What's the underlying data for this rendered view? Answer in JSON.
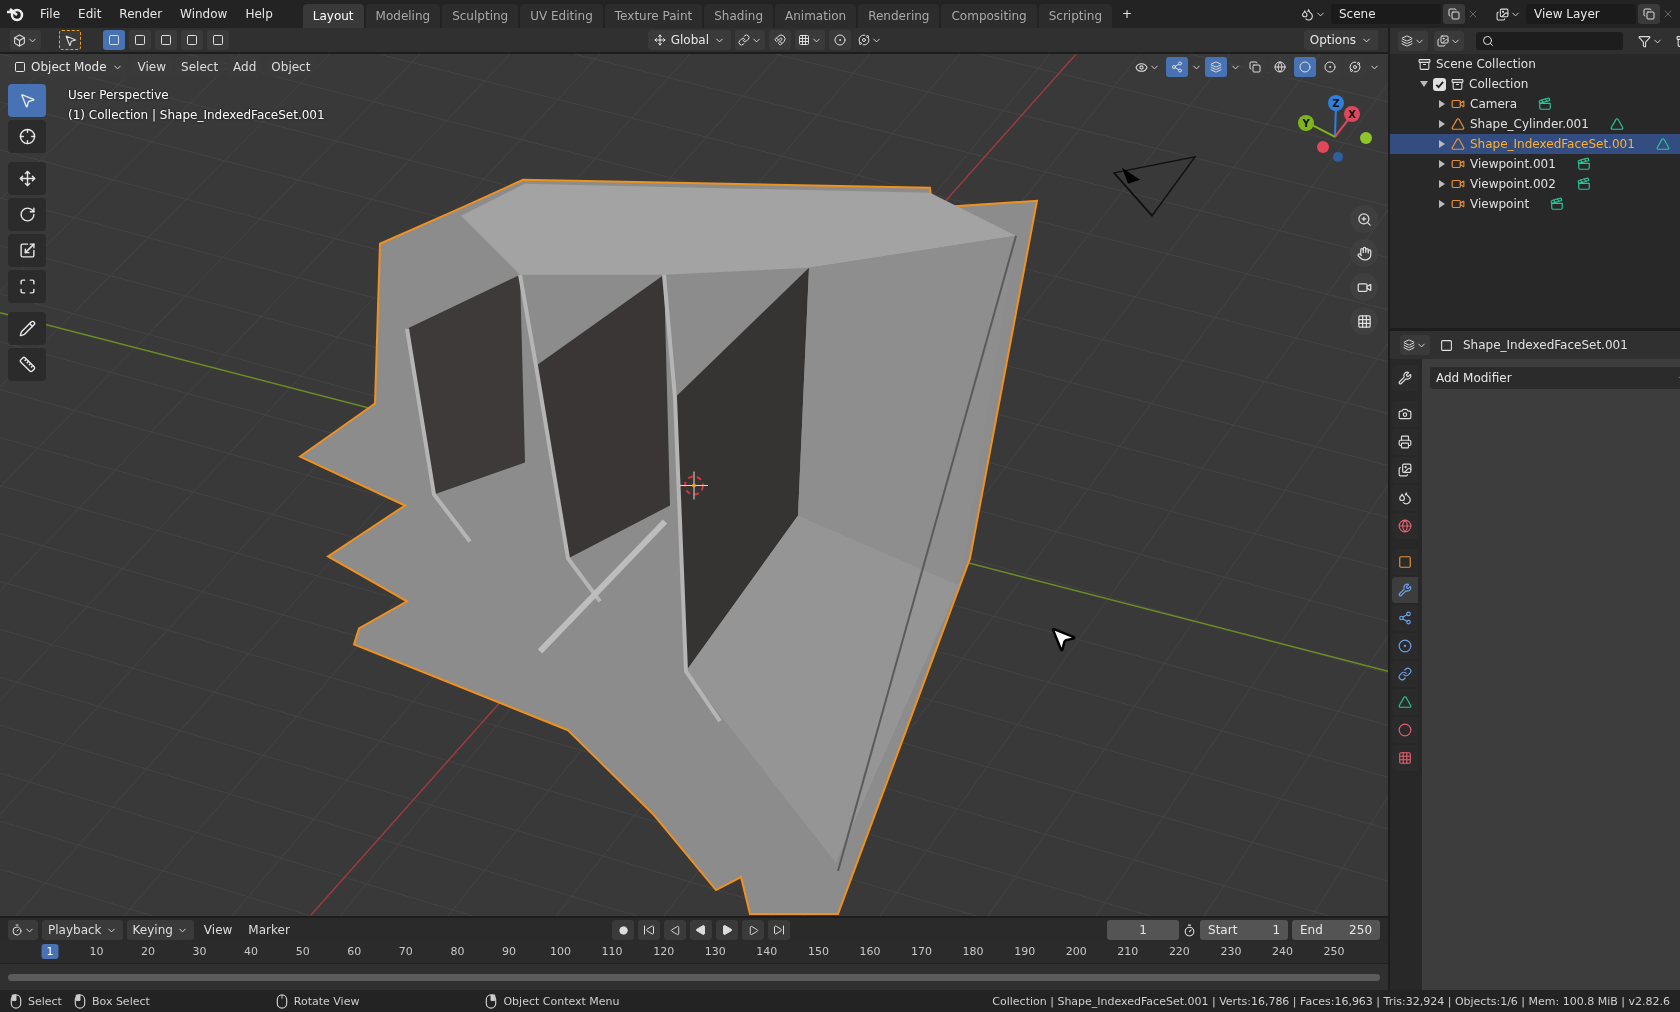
{
  "topbar": {
    "menus": [
      "File",
      "Edit",
      "Render",
      "Window",
      "Help"
    ],
    "workspaces": [
      {
        "label": "Layout",
        "selected": true
      },
      {
        "label": "Modeling",
        "selected": false
      },
      {
        "label": "Sculpting",
        "selected": false
      },
      {
        "label": "UV Editing",
        "selected": false
      },
      {
        "label": "Texture Paint",
        "selected": false
      },
      {
        "label": "Shading",
        "selected": false
      },
      {
        "label": "Animation",
        "selected": false
      },
      {
        "label": "Rendering",
        "selected": false
      },
      {
        "label": "Compositing",
        "selected": false
      },
      {
        "label": "Scripting",
        "selected": false
      }
    ],
    "add_workspace": "+",
    "scene": "Scene",
    "view_layer": "View Layer"
  },
  "tool_header": {
    "select_modes": [
      {
        "selected": true
      },
      {
        "selected": false
      },
      {
        "selected": false
      },
      {
        "selected": false
      },
      {
        "selected": false
      }
    ],
    "orientation": "Global",
    "options": "Options"
  },
  "viewport": {
    "mode": "Object Mode",
    "menus": [
      "View",
      "Select",
      "Add",
      "Object"
    ],
    "overlay_text": [
      "User Perspective",
      "(1) Collection | Shape_IndexedFaceSet.001"
    ],
    "gizmo_toggle": true,
    "overlay_toggle": true,
    "shading": [
      {
        "kind": "wireframe",
        "selected": false
      },
      {
        "kind": "solid",
        "selected": true
      },
      {
        "kind": "material",
        "selected": false
      },
      {
        "kind": "rendered",
        "selected": false
      }
    ],
    "tools": [
      {
        "kind": "select",
        "selected": true
      },
      {
        "kind": "cursor",
        "selected": false
      },
      {
        "kind": "move",
        "selected": false
      },
      {
        "kind": "rotate",
        "selected": false
      },
      {
        "kind": "scale",
        "selected": false
      },
      {
        "kind": "transform",
        "selected": false
      },
      {
        "kind": "annotate",
        "selected": false
      },
      {
        "kind": "measure",
        "selected": false
      }
    ],
    "gizmo_axes": [
      {
        "label": "Z",
        "color": "#2f7fdc"
      },
      {
        "label": "X",
        "color": "#e0475a"
      },
      {
        "label": "Y",
        "color": "#7fb51b"
      }
    ]
  },
  "outliner": {
    "root": "Scene Collection",
    "collections": [
      {
        "label": "Collection",
        "checked": true,
        "expanded": true,
        "children": [
          {
            "label": "Camera",
            "kind": "camera",
            "expanded": false,
            "selected": false
          },
          {
            "label": "Shape_Cylinder.001",
            "kind": "mesh",
            "expanded": false,
            "selected": false
          },
          {
            "label": "Shape_IndexedFaceSet.001",
            "kind": "mesh",
            "expanded": false,
            "selected": true
          },
          {
            "label": "Viewpoint.001",
            "kind": "camera",
            "expanded": false,
            "selected": false
          },
          {
            "label": "Viewpoint.002",
            "kind": "camera",
            "expanded": false,
            "selected": false
          },
          {
            "label": "Viewpoint",
            "kind": "camera",
            "expanded": false,
            "selected": false
          }
        ]
      }
    ]
  },
  "properties": {
    "object_name": "Shape_IndexedFaceSet.001",
    "add_modifier": "Add Modifier",
    "tabs": [
      {
        "kind": "tool",
        "selected": false
      },
      {
        "kind": "render",
        "selected": false
      },
      {
        "kind": "output",
        "selected": false
      },
      {
        "kind": "view_layer",
        "selected": false
      },
      {
        "kind": "scene",
        "selected": false
      },
      {
        "kind": "world",
        "selected": false
      },
      {
        "kind": "object",
        "selected": false
      },
      {
        "kind": "modifiers",
        "selected": true
      },
      {
        "kind": "particles",
        "selected": false
      },
      {
        "kind": "physics",
        "selected": false
      },
      {
        "kind": "constraints",
        "selected": false
      },
      {
        "kind": "data",
        "selected": false
      },
      {
        "kind": "material",
        "selected": false
      },
      {
        "kind": "texture",
        "selected": false
      }
    ]
  },
  "timeline": {
    "menus": [
      {
        "label": "Playback",
        "kind": "dropdown"
      },
      {
        "label": "Keying",
        "kind": "dropdown"
      },
      {
        "label": "View",
        "kind": "menu"
      },
      {
        "label": "Marker",
        "kind": "menu"
      }
    ],
    "current_frame": "1",
    "start_label": "Start",
    "start": "1",
    "end_label": "End",
    "end": "250",
    "playhead": "1",
    "ticks": [
      "10",
      "20",
      "30",
      "40",
      "50",
      "60",
      "70",
      "80",
      "90",
      "100",
      "110",
      "120",
      "130",
      "140",
      "150",
      "160",
      "170",
      "180",
      "190",
      "200",
      "210",
      "220",
      "230",
      "240",
      "250"
    ]
  },
  "status_bar": {
    "hints": [
      {
        "kind": "left",
        "label": "Select"
      },
      {
        "kind": "drag",
        "label": "Box Select"
      },
      {
        "kind": "middle",
        "label": "Rotate View"
      },
      {
        "kind": "right",
        "label": "Object Context Menu"
      }
    ],
    "stats": "Collection | Shape_IndexedFaceSet.001 | Verts:16,786 | Faces:16,963 | Tris:32,924 | Objects:1/6 | Mem: 100.8 MiB | v2.82.6"
  }
}
